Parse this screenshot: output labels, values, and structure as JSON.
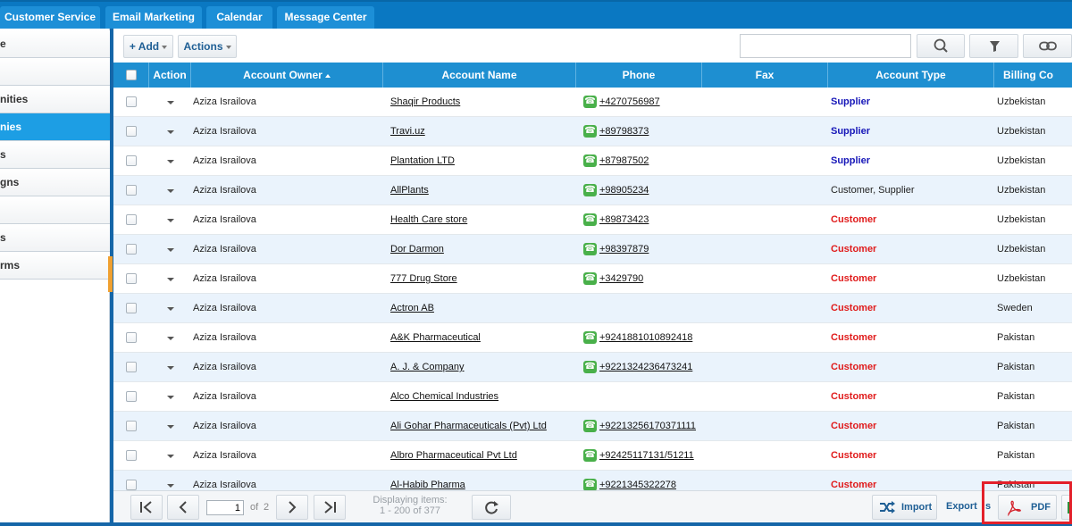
{
  "top_tabs": [
    {
      "label": "Customer Service"
    },
    {
      "label": "Email Marketing"
    },
    {
      "label": "Calendar"
    },
    {
      "label": "Message Center"
    }
  ],
  "sidebar": {
    "items": [
      {
        "label": "e"
      },
      {
        "label": ""
      },
      {
        "label": "nities"
      },
      {
        "label": "nies"
      },
      {
        "label": "s"
      },
      {
        "label": "gns"
      },
      {
        "label": ""
      },
      {
        "label": "s"
      },
      {
        "label": "rms"
      }
    ],
    "active_index": 3
  },
  "toolbar": {
    "add_label": "+ Add",
    "actions_label": "Actions",
    "search_value": "",
    "search_placeholder": ""
  },
  "grid": {
    "columns": {
      "action": "Action",
      "owner": "Account Owner",
      "name": "Account Name",
      "phone": "Phone",
      "fax": "Fax",
      "type": "Account Type",
      "billing": "Billing Co"
    },
    "rows": [
      {
        "owner": "Aziza Israilova",
        "name": "Shaqir Products",
        "phone": "+4270756987",
        "fax": "",
        "type": "Supplier",
        "billing": "Uzbekistan"
      },
      {
        "owner": "Aziza Israilova",
        "name": "Travi.uz",
        "phone": "+89798373",
        "fax": "",
        "type": "Supplier",
        "billing": "Uzbekistan"
      },
      {
        "owner": "Aziza Israilova",
        "name": "Plantation LTD",
        "phone": "+87987502",
        "fax": "",
        "type": "Supplier",
        "billing": "Uzbekistan"
      },
      {
        "owner": "Aziza Israilova",
        "name": "AllPlants",
        "phone": "+98905234",
        "fax": "",
        "type": "Customer, Supplier",
        "billing": "Uzbekistan"
      },
      {
        "owner": "Aziza Israilova",
        "name": "Health Care store",
        "phone": "+89873423",
        "fax": "",
        "type": "Customer",
        "billing": "Uzbekistan"
      },
      {
        "owner": "Aziza Israilova",
        "name": "Dor Darmon",
        "phone": "+98397879",
        "fax": "",
        "type": "Customer",
        "billing": "Uzbekistan"
      },
      {
        "owner": "Aziza Israilova",
        "name": "777 Drug Store",
        "phone": "+3429790",
        "fax": "",
        "type": "Customer",
        "billing": "Uzbekistan"
      },
      {
        "owner": "Aziza Israilova",
        "name": "Actron AB",
        "phone": "",
        "fax": "",
        "type": "Customer",
        "billing": "Sweden"
      },
      {
        "owner": "Aziza Israilova",
        "name": "A&K Pharmaceutical",
        "phone": "+9241881010892418",
        "fax": "",
        "type": "Customer",
        "billing": "Pakistan"
      },
      {
        "owner": "Aziza Israilova",
        "name": "A. J. & Company",
        "phone": "+9221324236473241",
        "fax": "",
        "type": "Customer",
        "billing": "Pakistan"
      },
      {
        "owner": "Aziza Israilova",
        "name": "Alco Chemical Industries",
        "phone": "",
        "fax": "",
        "type": "Customer",
        "billing": "Pakistan"
      },
      {
        "owner": "Aziza Israilova",
        "name": "Ali Gohar Pharmaceuticals (Pvt) Ltd",
        "phone": "+92213256170371111",
        "fax": "",
        "type": "Customer",
        "billing": "Pakistan"
      },
      {
        "owner": "Aziza Israilova",
        "name": "Albro Pharmaceutical Pvt Ltd",
        "phone": "+92425117131/51211",
        "fax": "",
        "type": "Customer",
        "billing": "Pakistan"
      },
      {
        "owner": "Aziza Israilova",
        "name": "Al-Habib Pharma",
        "phone": "+9221345322278",
        "fax": "",
        "type": "Customer",
        "billing": "Pakistan"
      }
    ]
  },
  "pager": {
    "current_page": "1",
    "of_label": "of",
    "total_pages": "2",
    "displaying_label": "Displaying items:",
    "range_label": "1 - 200 of 377"
  },
  "footer_actions": {
    "import_label": "Import",
    "export_label": "Export",
    "export_suffix": "s",
    "pdf_label": "PDF"
  },
  "colors": {
    "accent": "#1e8fd1",
    "supplier": "#1616b8",
    "customer": "#e01b1b",
    "phone_icon": "#49b04a",
    "highlight": "#e3202a"
  }
}
